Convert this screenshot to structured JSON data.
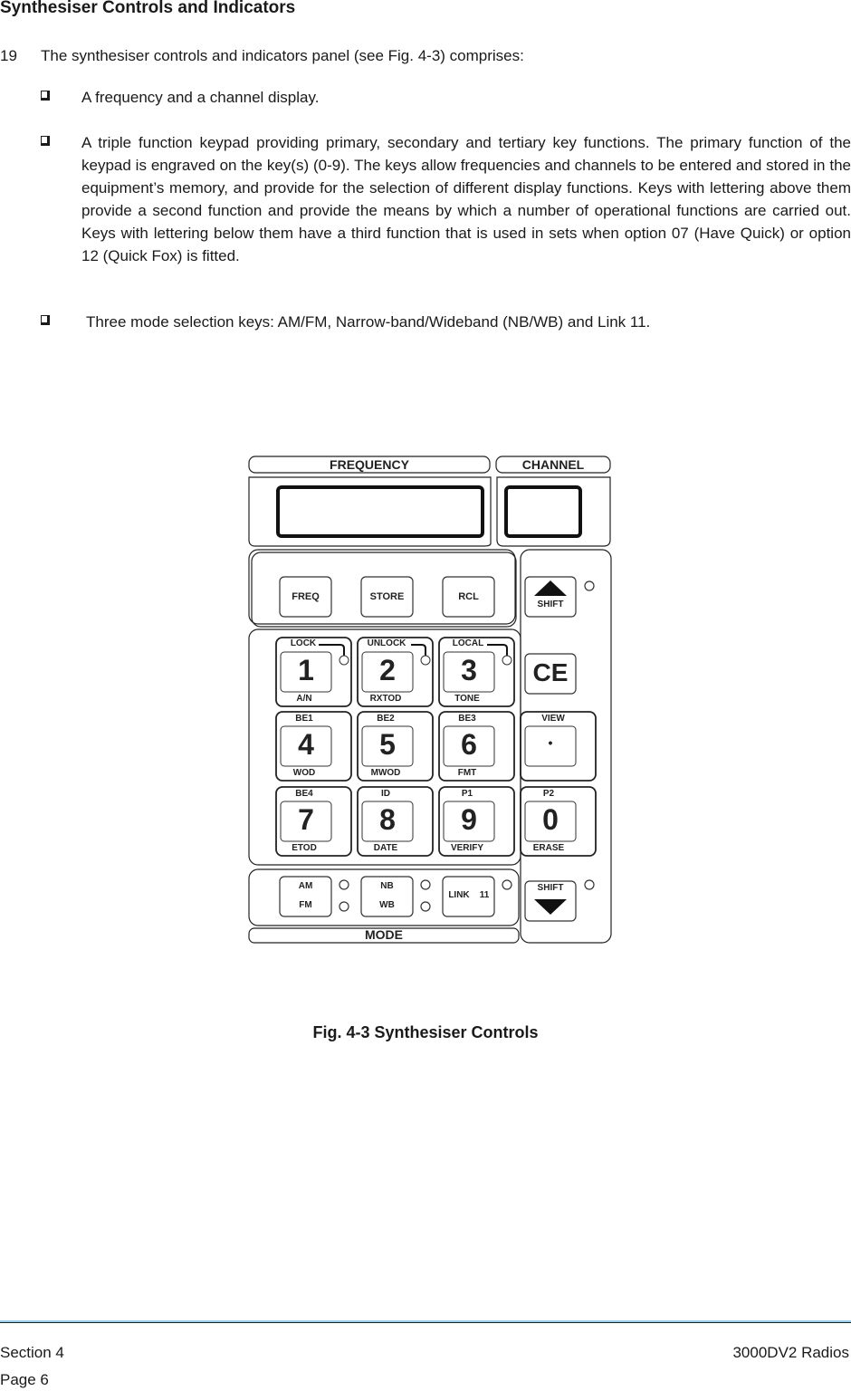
{
  "heading": "Synthesiser Controls and Indicators",
  "paragraph": {
    "number": "19",
    "intro": "The synthesiser controls and indicators panel (see Fig. 4-3) comprises:"
  },
  "bullets": [
    "A frequency and a channel display.",
    "A triple function keypad providing primary, secondary and tertiary key functions. The primary function of the keypad is engraved on the key(s) (0-9).  The keys allow frequencies and channels to be entered and stored in the equipment’s memory, and provide for the selection of different display functions.  Keys with lettering above them provide a second function and provide the means by which a number of operational functions are carried out. Keys with lettering below them have a third function that is used in sets when option 07 (Have Quick) or option 12 (Quick Fox) is fitted.",
    "Three mode selection keys: AM/FM, Narrow-band/Wideband (NB/WB) and Link 11."
  ],
  "figure": {
    "frequency_label": "FREQUENCY",
    "channel_label": "CHANNEL",
    "function_keys": [
      "FREQ",
      "STORE",
      "RCL"
    ],
    "shift_up_label": "SHIFT",
    "shift_down_label": "SHIFT",
    "ce_label": "CE",
    "keypad": [
      {
        "digit": "1",
        "above": "LOCK",
        "below": "A/N",
        "indicator": true
      },
      {
        "digit": "2",
        "above": "UNLOCK",
        "below": "RXTOD",
        "indicator": true
      },
      {
        "digit": "3",
        "above": "LOCAL",
        "below": "TONE",
        "indicator": true
      },
      {
        "digit": "4",
        "above": "BE1",
        "below": "WOD"
      },
      {
        "digit": "5",
        "above": "BE2",
        "below": "MWOD"
      },
      {
        "digit": "6",
        "above": "BE3",
        "below": "FMT"
      },
      {
        "digit": "•",
        "above": "VIEW",
        "below": ""
      },
      {
        "digit": "7",
        "above": "BE4",
        "below": "ETOD"
      },
      {
        "digit": "8",
        "above": "ID",
        "below": "DATE"
      },
      {
        "digit": "9",
        "above": "P1",
        "below": "VERIFY"
      },
      {
        "digit": "0",
        "above": "P2",
        "below": "ERASE"
      }
    ],
    "mode_keys": [
      {
        "top": "AM",
        "bottom": "FM"
      },
      {
        "top": "NB",
        "bottom": "WB"
      },
      {
        "top": "LINK",
        "bottom": "11"
      }
    ],
    "mode_label": "MODE",
    "caption": "Fig. 4-3  Synthesiser Controls"
  },
  "footer": {
    "section": "Section 4",
    "page": "Page 6",
    "product": "3000DV2 Radios",
    "rule_color": "#8fd3f0"
  }
}
